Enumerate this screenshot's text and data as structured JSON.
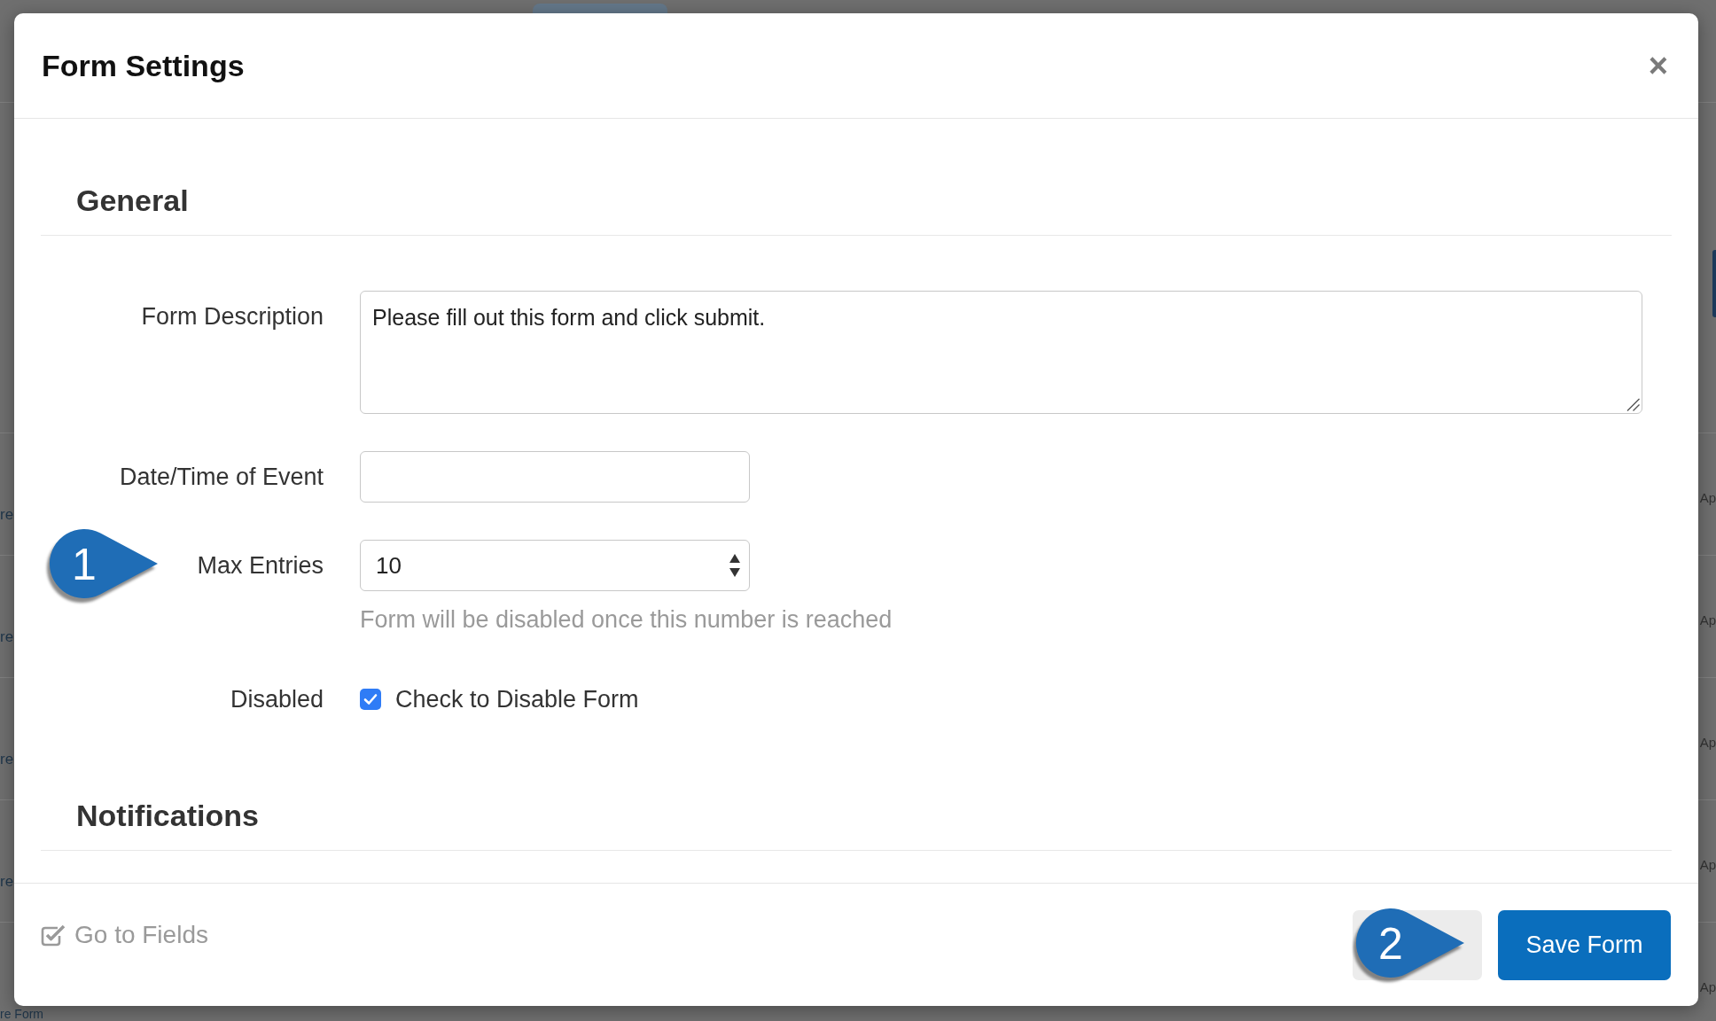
{
  "background_page": {
    "rows": [
      {
        "column_1": "re",
        "column_2": "Ap"
      },
      {
        "column_1": "re",
        "column_2": "Ap"
      },
      {
        "column_1": "re",
        "column_2": "Ap"
      },
      {
        "column_1": "re",
        "column_2": "Ap"
      },
      {
        "column_1": "re Form",
        "column_2": "Ap"
      }
    ]
  },
  "dialog": {
    "title": "Form Settings",
    "close": "×",
    "sections": [
      {
        "heading": "General",
        "fields": [
          {
            "kind": "textarea",
            "label": "Form Description",
            "value": "Please fill out this form and click submit."
          },
          {
            "kind": "text",
            "label": "Date/Time of Event"
          },
          {
            "kind": "select",
            "label": "Max Entries",
            "value": "10",
            "help": "Form will be disabled once this number is reached",
            "callout": "1"
          },
          {
            "kind": "checkbox",
            "label": "Disabled",
            "option": "Check to Disable Form",
            "checked": true
          }
        ]
      },
      {
        "heading": "Notifications"
      }
    ],
    "footer": {
      "link": {
        "label": "Go to Fields"
      },
      "buttons": [
        {
          "kind": "secondary",
          "callout": "2"
        },
        {
          "kind": "primary",
          "label": "Save Form"
        }
      ]
    }
  }
}
